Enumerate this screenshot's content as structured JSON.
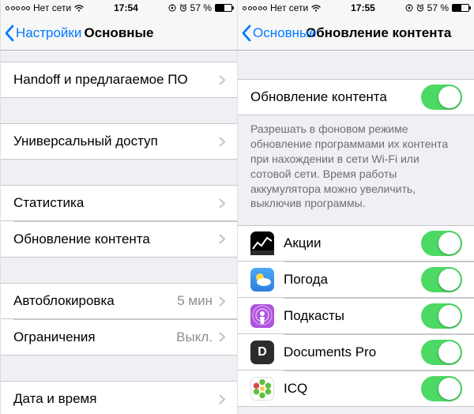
{
  "left": {
    "status": {
      "carrier": "Нет сети",
      "time": "17:54",
      "battery_pct": "57 %",
      "battery_fill": 57
    },
    "nav": {
      "back": "Настройки",
      "title": "Основные"
    },
    "groups": [
      {
        "rows": [
          {
            "label": "Handoff и предлагаемое ПО"
          }
        ]
      },
      {
        "rows": [
          {
            "label": "Универсальный доступ"
          }
        ]
      },
      {
        "rows": [
          {
            "label": "Статистика"
          },
          {
            "label": "Обновление контента"
          }
        ]
      },
      {
        "rows": [
          {
            "label": "Автоблокировка",
            "value": "5 мин"
          },
          {
            "label": "Ограничения",
            "value": "Выкл."
          }
        ]
      },
      {
        "rows": [
          {
            "label": "Дата и время"
          }
        ]
      }
    ]
  },
  "right": {
    "status": {
      "carrier": "Нет сети",
      "time": "17:55",
      "battery_pct": "57 %",
      "battery_fill": 57
    },
    "nav": {
      "back": "Основные",
      "title": "Обновление контента"
    },
    "master": {
      "label": "Обновление контента"
    },
    "footer": "Разрешать в фоновом режиме обновление программами их контента при нахождении в сети Wi-Fi или сотовой сети. Время работы аккумулятора можно увеличить, выключив программы.",
    "apps": [
      {
        "label": "Акции",
        "icon": "stocks"
      },
      {
        "label": "Погода",
        "icon": "weather"
      },
      {
        "label": "Подкасты",
        "icon": "podcasts"
      },
      {
        "label": "Documents Pro",
        "icon": "documents"
      },
      {
        "label": "ICQ",
        "icon": "icq"
      }
    ]
  },
  "colors": {
    "ios_blue": "#007aff",
    "ios_green": "#4cd964",
    "row_sep": "#c8c7cc",
    "bg": "#efeff4"
  }
}
